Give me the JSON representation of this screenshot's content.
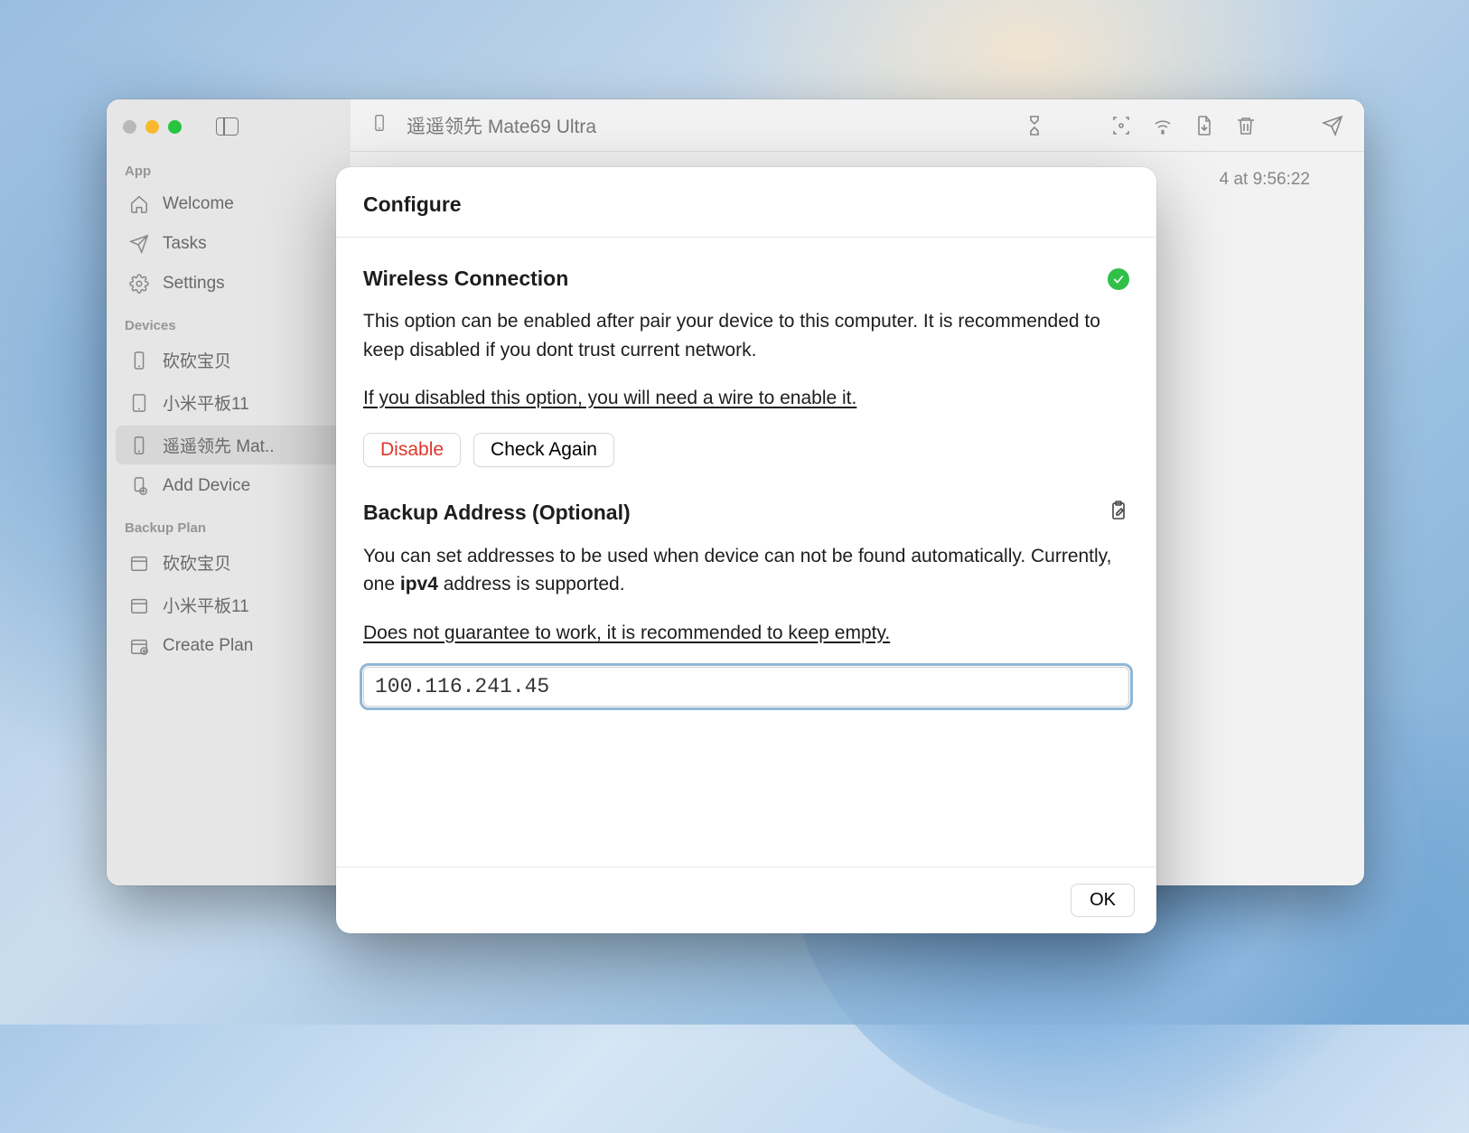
{
  "window": {
    "title": "遥遥领先 Mate69 Ultra"
  },
  "sidebar": {
    "sections": {
      "app": {
        "label": "App",
        "items": [
          {
            "label": "Welcome"
          },
          {
            "label": "Tasks"
          },
          {
            "label": "Settings"
          }
        ]
      },
      "devices": {
        "label": "Devices",
        "items": [
          {
            "label": "砍砍宝贝"
          },
          {
            "label": "小米平板11"
          },
          {
            "label": "遥遥领先 Mat.."
          },
          {
            "label": "Add Device"
          }
        ]
      },
      "backup_plan": {
        "label": "Backup Plan",
        "items": [
          {
            "label": "砍砍宝贝"
          },
          {
            "label": "小米平板11"
          },
          {
            "label": "Create Plan"
          }
        ]
      }
    }
  },
  "content": {
    "timestamp_visible": "4 at 9:56:22"
  },
  "modal": {
    "title": "Configure",
    "wireless": {
      "title": "Wireless Connection",
      "status": "enabled",
      "description": "This option can be enabled after pair your device to this computer. It is recommended to keep disabled if you dont trust current network.",
      "warning": "If you disabled this option, you will need a wire to enable it.",
      "disable_label": "Disable",
      "check_label": "Check Again"
    },
    "backup_address": {
      "title": "Backup Address (Optional)",
      "description_pre": "You can set addresses to be used when device can not be found automatically. Currently, one ",
      "description_bold": "ipv4",
      "description_post": " address is supported.",
      "warning": "Does not guarantee to work, it is recommended to keep empty.",
      "value": "100.116.241.45"
    },
    "ok_label": "OK"
  }
}
